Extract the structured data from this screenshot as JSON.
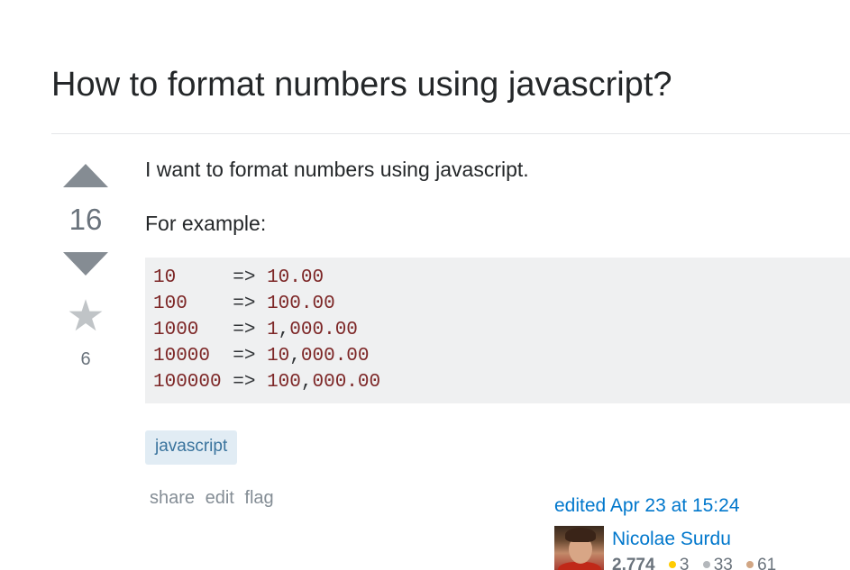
{
  "question": {
    "title": "How to format numbers using javascript?",
    "votes": "16",
    "favorites": "6",
    "body": {
      "paragraph1": "I want to format numbers using javascript.",
      "paragraph2": "For example:"
    },
    "code_lines": [
      {
        "input": "10",
        "pad": "     ",
        "arrow": "=>",
        "out_a": "10",
        "sep": "",
        "out_b": ".00"
      },
      {
        "input": "100",
        "pad": "    ",
        "arrow": "=>",
        "out_a": "100",
        "sep": "",
        "out_b": ".00"
      },
      {
        "input": "1000",
        "pad": "   ",
        "arrow": "=>",
        "out_a": "1",
        "sep": ",",
        "out_b": "000.00"
      },
      {
        "input": "10000",
        "pad": "  ",
        "arrow": "=>",
        "out_a": "10",
        "sep": ",",
        "out_b": "000.00"
      },
      {
        "input": "100000",
        "pad": " ",
        "arrow": "=>",
        "out_a": "100",
        "sep": ",",
        "out_b": "000.00"
      }
    ],
    "tags": [
      "javascript"
    ],
    "menu": {
      "share": "share",
      "edit": "edit",
      "flag": "flag"
    },
    "edited": "edited Apr 23 at 15:24",
    "editor": {
      "name": "Nicolae Surdu",
      "reputation": "2,774",
      "gold": "3",
      "silver": "33",
      "bronze": "61"
    }
  },
  "colors": {
    "link": "#0077cc",
    "tag_bg": "#e1ecf4",
    "tag_text": "#39739d",
    "code_bg": "#eff0f1",
    "code_literal": "#7d2727"
  },
  "icons": {
    "upvote": "triangle-up-icon",
    "downvote": "triangle-down-icon",
    "favorite": "star-icon"
  }
}
